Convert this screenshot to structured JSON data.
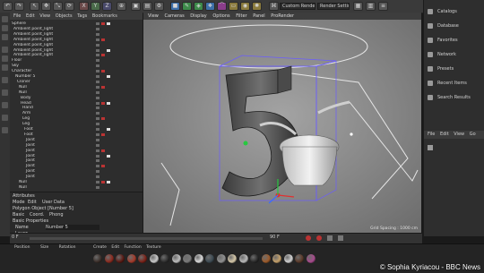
{
  "toolbar": {
    "render_view_field": "Custom Render View",
    "render_settings_field": "Render Settings"
  },
  "object_manager": {
    "menu": [
      "File",
      "Edit",
      "View",
      "Objects",
      "Tags",
      "Bookmarks"
    ],
    "rows": [
      "Sphere",
      "Ambient point_light",
      "Ambient point_light",
      "Ambient point_light",
      "Ambient point_light",
      "Ambient point_light",
      "Ambient point_light",
      "Floor",
      "Sky",
      "Character",
      "Number 5",
      "Cloner",
      "Null",
      "Null",
      "Body",
      "Head",
      "Hand",
      "Arm",
      "Leg",
      "Leg",
      "Foot",
      "Foot",
      "Joint",
      "Joint",
      "Joint",
      "Joint",
      "Joint",
      "Joint",
      "Joint",
      "Joint",
      "Null",
      "Null"
    ]
  },
  "attributes": {
    "header": "Attributes",
    "menu": [
      "Mode",
      "Edit",
      "User Data"
    ],
    "object_title": "Polygon Object [Number 5]",
    "tabs": [
      "Basic",
      "Coord.",
      "Phong"
    ],
    "section": "Basic Properties",
    "name_label": "Name",
    "name_value": "Number 5",
    "layer_label": "Layer"
  },
  "viewport": {
    "menu": [
      "View",
      "Cameras",
      "Display",
      "Options",
      "Filter",
      "Panel",
      "ProRender"
    ],
    "grid_spacing": "Grid Spacing : 1000 cm",
    "model_number": "5"
  },
  "right_panel": {
    "items": [
      "Catalogs",
      "Database",
      "Favorites",
      "Network",
      "Presets",
      "Recent Items",
      "Search Results"
    ],
    "tabs": [
      "File",
      "Edit",
      "View",
      "Go"
    ]
  },
  "timeline": {
    "start_frame": "0 F",
    "end_frame": "90 F"
  },
  "materials": {
    "menu": [
      "Create",
      "Edit",
      "Function",
      "Texture"
    ],
    "coords_headers": [
      "Position",
      "Size",
      "Rotation"
    ],
    "colors": [
      "#3b2f2a",
      "#8a2a1f",
      "#5a1a14",
      "#a33a2a",
      "#7a2218",
      "#c8c8c8",
      "#2e2e2e",
      "#bdbdbd",
      "#7a7a7a",
      "#d9d9d9",
      "#3d4a52",
      "#8f8f8f",
      "#d5c7a8",
      "#b8b8b8",
      "#2a2a2a",
      "#9c5a2a",
      "#c4a06a",
      "#d0d0d0",
      "#5a3a2a",
      "#a74a8c"
    ]
  },
  "credit": "© Sophia Kyriacou - BBC News"
}
